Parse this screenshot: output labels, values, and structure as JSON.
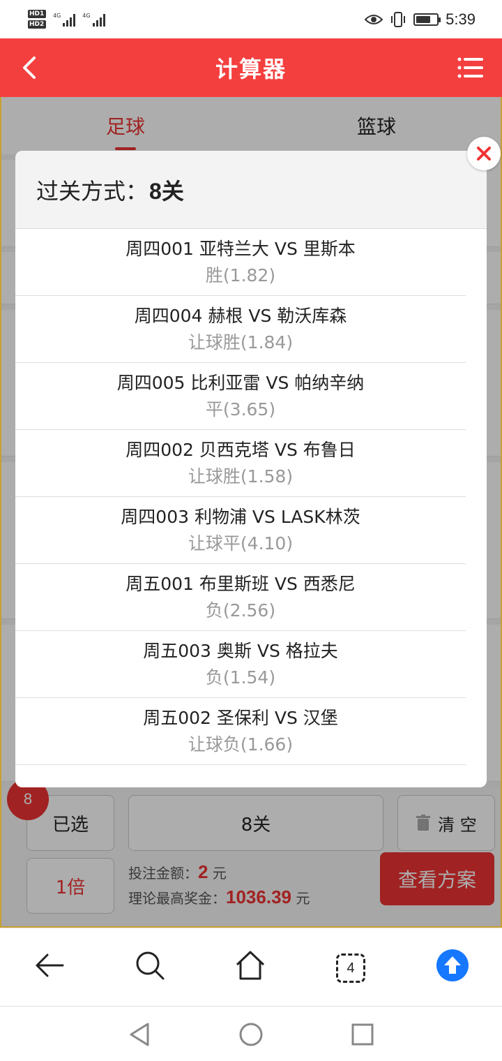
{
  "status_bar": {
    "time": "5:39",
    "network_tag": "4G",
    "sim_labels": [
      "HD1",
      "HD2"
    ],
    "battery_percent": 75
  },
  "header": {
    "title": "计算器",
    "back_icon": "chevron-left-icon",
    "menu_icon": "list-menu-icon"
  },
  "tabs": [
    {
      "label": "足球",
      "active": true
    },
    {
      "label": "篮球",
      "active": false
    }
  ],
  "modal": {
    "title_label": "过关方式：",
    "title_value": "8关",
    "close_icon": "close-icon",
    "matches": [
      {
        "teams": "周四001 亚特兰大 VS 里斯本",
        "pick": "胜(1.82)"
      },
      {
        "teams": "周四004 赫根 VS 勒沃库森",
        "pick": "让球胜(1.84)"
      },
      {
        "teams": "周四005 比利亚雷 VS 帕纳辛纳",
        "pick": "平(3.65)"
      },
      {
        "teams": "周四002 贝西克塔 VS 布鲁日",
        "pick": "让球胜(1.58)"
      },
      {
        "teams": "周四003 利物浦 VS LASK林茨",
        "pick": "让球平(4.10)"
      },
      {
        "teams": "周五001 布里斯班 VS 西悉尼",
        "pick": "负(2.56)"
      },
      {
        "teams": "周五003 奥斯 VS 格拉夫",
        "pick": "负(1.54)"
      },
      {
        "teams": "周五002 圣保利 VS 汉堡",
        "pick": "让球负(1.66)"
      }
    ]
  },
  "bottom": {
    "selected_count": "8",
    "selected_label": "已选",
    "pass_mode": "8关",
    "clear_label": "清 空",
    "multiplier": "1倍",
    "bet_amount_label": "投注金额：",
    "bet_amount": "2",
    "currency": "元",
    "max_prize_label": "理论最高奖金：",
    "max_prize": "1036.39",
    "view_plan": "查看方案"
  },
  "browser_toolbar": {
    "tab_count": "4",
    "icons": [
      "back-arrow-icon",
      "search-icon",
      "home-icon",
      "tabs-icon",
      "upload-icon"
    ]
  },
  "colors": {
    "brand_red": "#f43f3f",
    "accent_red": "#e33333",
    "upload_blue": "#1677ff"
  }
}
